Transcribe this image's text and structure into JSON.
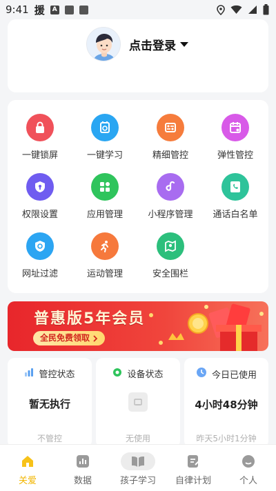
{
  "status_bar": {
    "time": "9:41",
    "app_char": "援",
    "notif_letter": "A"
  },
  "profile": {
    "login_label": "点击登录"
  },
  "features": [
    {
      "label": "一键锁屏",
      "icon": "lock-icon",
      "color": "#f0515a"
    },
    {
      "label": "一键学习",
      "icon": "study-clock-icon",
      "color": "#2aa6f2"
    },
    {
      "label": "精细管控",
      "icon": "fine-control-icon",
      "color": "#f67c3c"
    },
    {
      "label": "弹性管控",
      "icon": "calendar-control-icon",
      "color": "#d85ae8"
    },
    {
      "label": "权限设置",
      "icon": "shield-key-icon",
      "color": "#6f5cf0"
    },
    {
      "label": "应用管理",
      "icon": "apps-grid-icon",
      "color": "#2fc45c"
    },
    {
      "label": "小程序管理",
      "icon": "mini-program-icon",
      "color": "#a86cf0"
    },
    {
      "label": "通话白名单",
      "icon": "call-whitelist-icon",
      "color": "#2ec39a"
    },
    {
      "label": "网址过滤",
      "icon": "web-filter-icon",
      "color": "#2ca5f2"
    },
    {
      "label": "运动管理",
      "icon": "running-icon",
      "color": "#f6793c"
    },
    {
      "label": "安全围栏",
      "icon": "map-fence-icon",
      "color": "#2cbf7c"
    }
  ],
  "banner": {
    "title": "普惠版5年会员",
    "button_label": "全民免费领取"
  },
  "stats": [
    {
      "title": "管控状态",
      "value": "暂无执行",
      "foot": "不管控",
      "icon": "bar-chart-icon",
      "color": "#5aa0f0"
    },
    {
      "title": "设备状态",
      "value": "",
      "foot": "无使用",
      "icon": "status-dot-icon",
      "color": "#2fc45c"
    },
    {
      "title": "今日已使用",
      "value": "4小时48分钟",
      "foot": "昨天5小时1分钟",
      "icon": "clock-icon",
      "color": "#6aa6f5"
    }
  ],
  "nav": [
    {
      "label": "关爱",
      "icon": "home-icon",
      "active": true
    },
    {
      "label": "数据",
      "icon": "chart-icon",
      "active": false
    },
    {
      "label": "孩子学习",
      "icon": "book-icon",
      "active": false
    },
    {
      "label": "自律计划",
      "icon": "plan-edit-icon",
      "active": false
    },
    {
      "label": "个人",
      "icon": "profile-icon",
      "active": false
    }
  ],
  "colors": {
    "accent": "#f2b600",
    "banner_red": "#e8262b"
  }
}
